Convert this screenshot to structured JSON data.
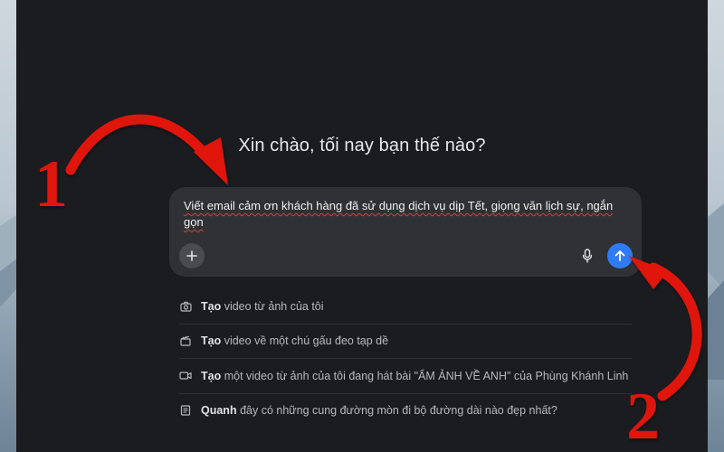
{
  "greeting": "Xin chào, tối nay bạn thế nào?",
  "composer": {
    "prompt": "Viết email cảm ơn khách hàng đã sử dụng dịch vụ dịp Tết, giọng văn lịch sự, ngắn gọn",
    "add_icon": "plus-icon",
    "mic_icon": "microphone-icon",
    "send_icon": "arrow-up-icon"
  },
  "suggestions": [
    {
      "icon": "camera-icon",
      "bold": "Tạo",
      "rest": " video từ ảnh của tôi"
    },
    {
      "icon": "clapperboard-icon",
      "bold": "Tạo",
      "rest": " video về một chú gấu đeo tạp dề"
    },
    {
      "icon": "video-icon",
      "bold": "Tạo",
      "rest": " một video từ ảnh của tôi đang hát bài \"ẨM ẢNH VỀ ANH\" của Phùng Khánh Linh"
    },
    {
      "icon": "document-icon",
      "bold": "Quanh",
      "rest": " đây có những cung đường mòn đi bộ đường dài nào đẹp nhất?"
    }
  ],
  "annotations": {
    "step1": "1",
    "step2": "2",
    "arrow_color": "#e0130f"
  }
}
